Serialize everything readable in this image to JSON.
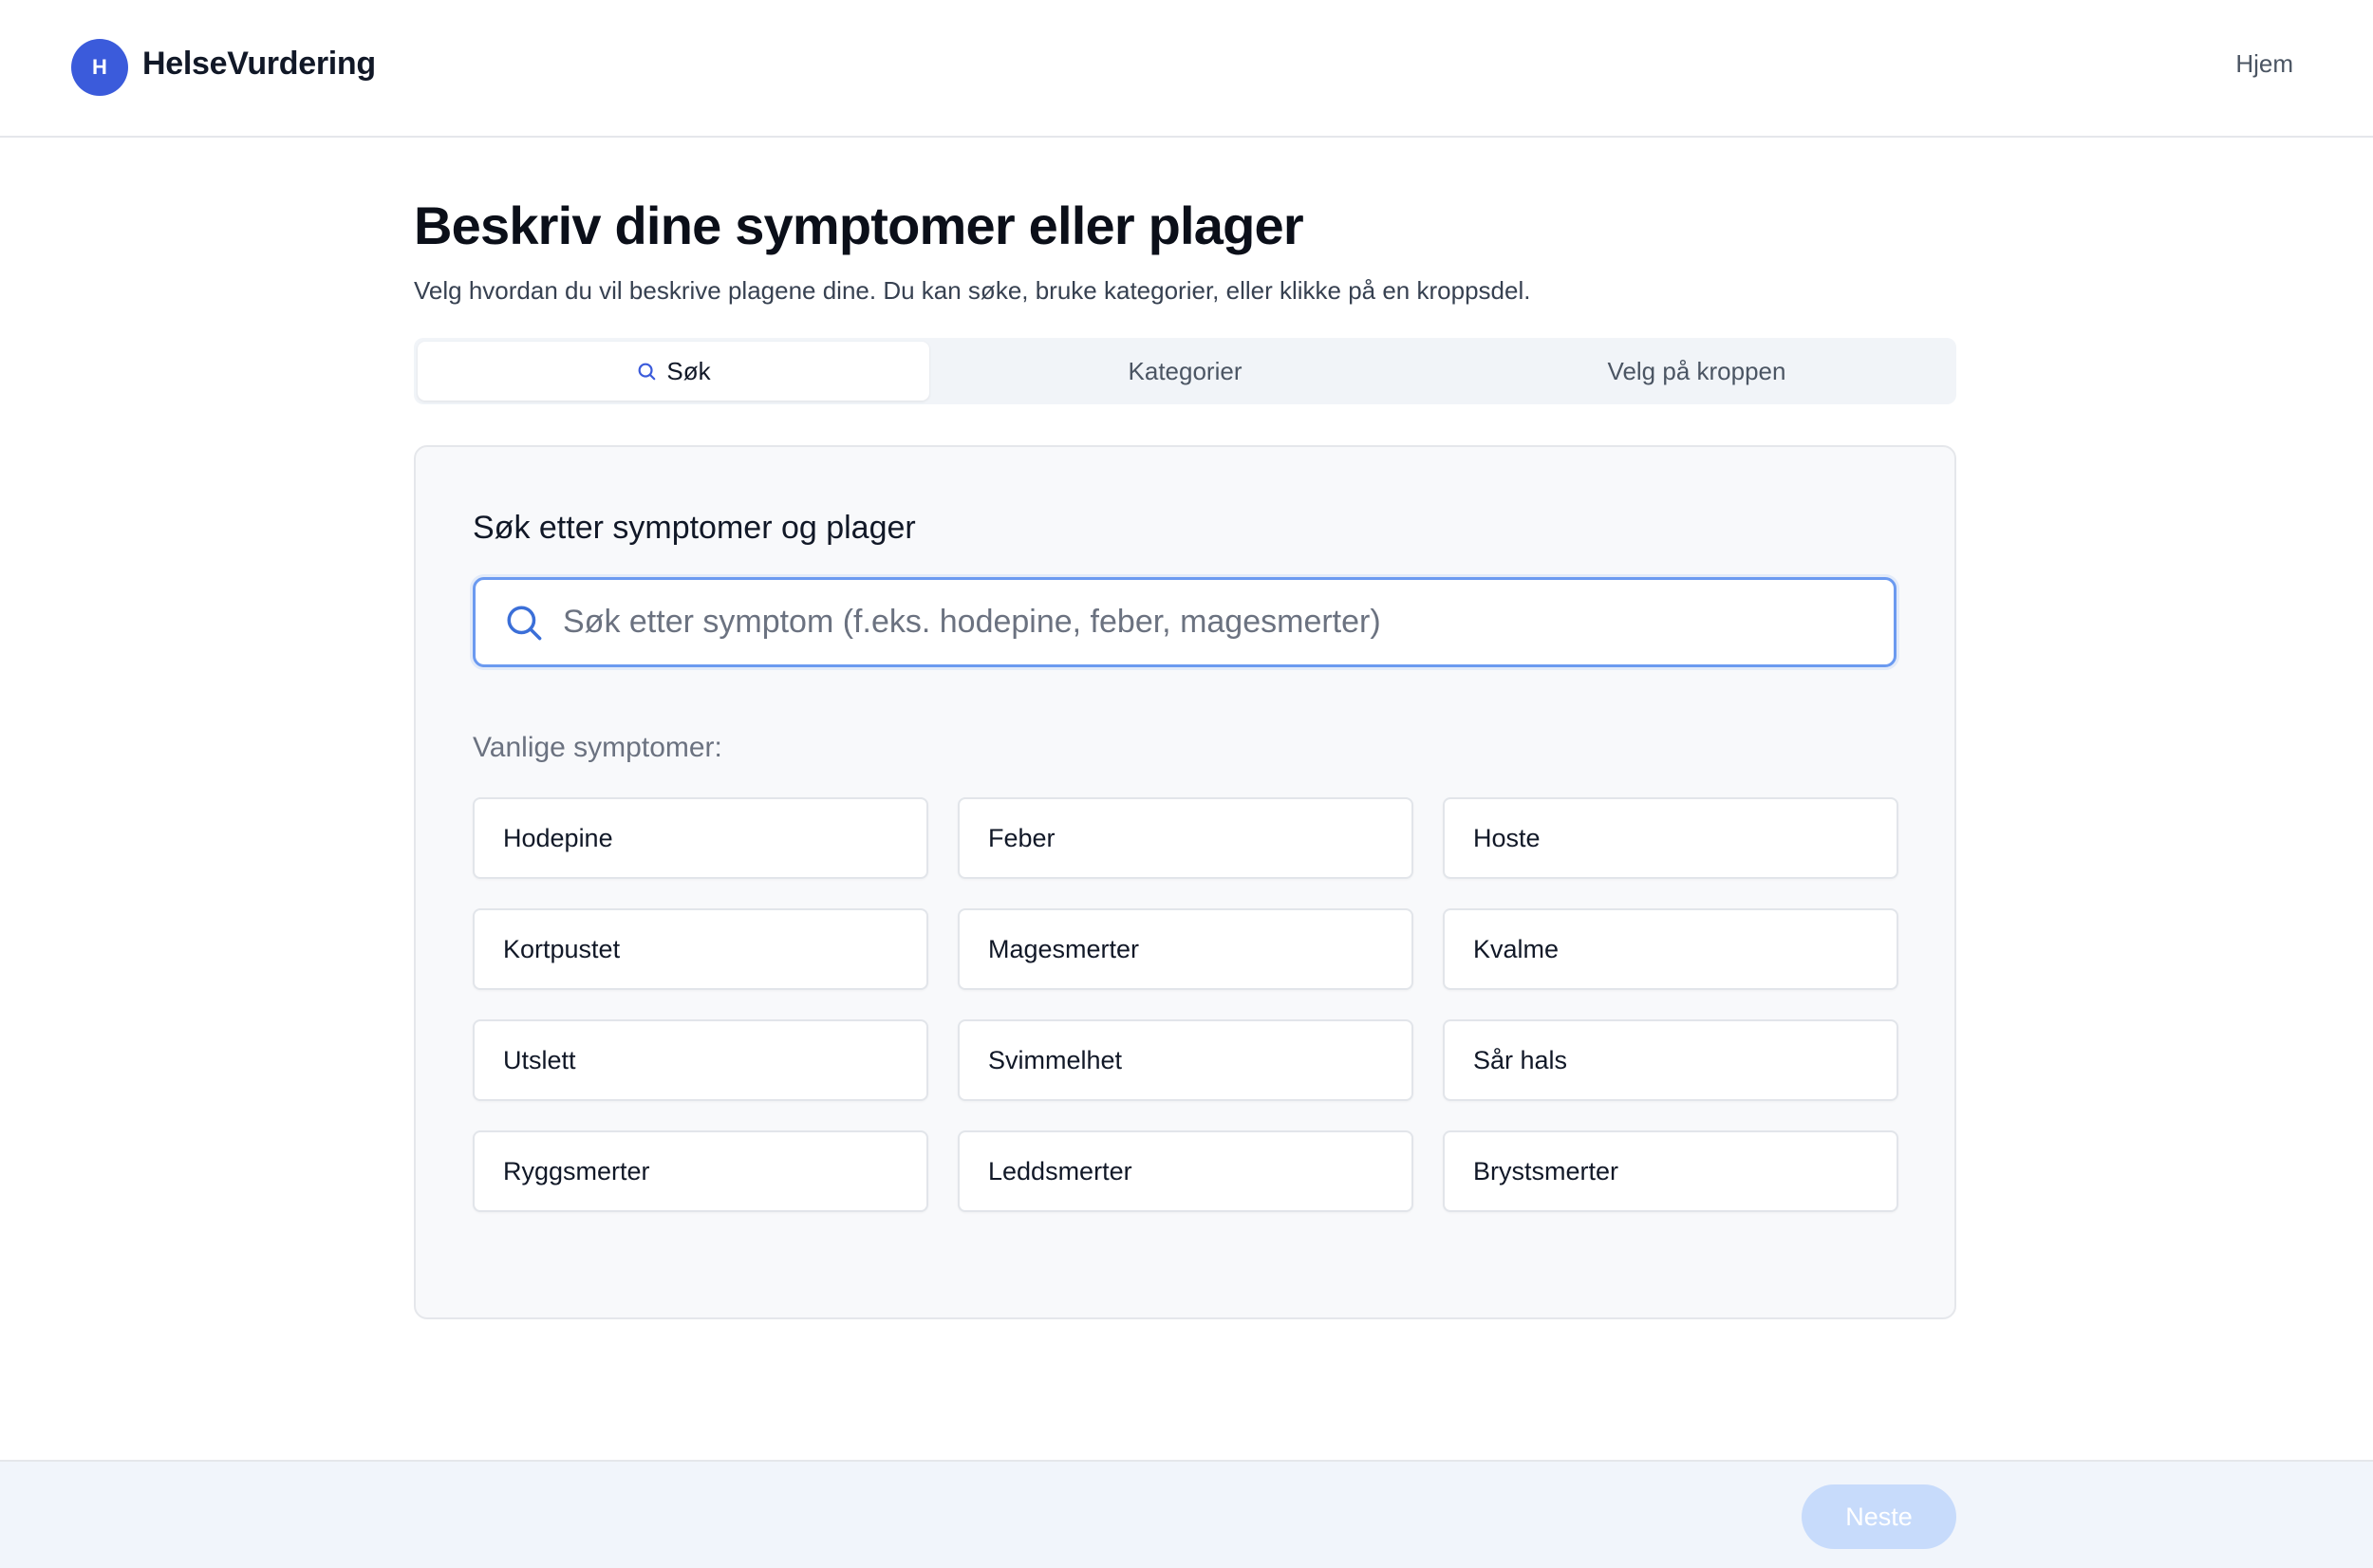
{
  "header": {
    "logo_letter": "H",
    "brand": "HelseVurdering",
    "nav_home": "Hjem"
  },
  "main": {
    "title": "Beskriv dine symptomer eller plager",
    "subtitle": "Velg hvordan du vil beskrive plagene dine. Du kan søke, bruke kategorier, eller klikke på en kroppsdel.",
    "tabs": [
      {
        "label": "Søk",
        "active": true
      },
      {
        "label": "Kategorier",
        "active": false
      },
      {
        "label": "Velg på kroppen",
        "active": false
      }
    ],
    "search_card": {
      "title": "Søk etter symptomer og plager",
      "search_placeholder": "Søk etter symptom (f.eks. hodepine, feber, magesmerter)",
      "search_value": "",
      "common_label": "Vanlige symptomer:",
      "symptoms": [
        "Hodepine",
        "Feber",
        "Hoste",
        "Kortpustet",
        "Magesmerter",
        "Kvalme",
        "Utslett",
        "Svimmelhet",
        "Sår hals",
        "Ryggsmerter",
        "Leddsmerter",
        "Brystsmerter"
      ]
    }
  },
  "footer": {
    "next_label": "Neste"
  },
  "colors": {
    "accent": "#3b5bdb",
    "search_border": "#6b9af0",
    "next_disabled": "#c7dbfb"
  }
}
